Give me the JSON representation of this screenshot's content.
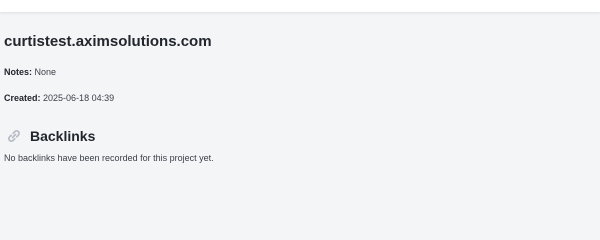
{
  "project": {
    "title": "curtistest.aximsolutions.com",
    "notes_label": "Notes:",
    "notes_value": "None",
    "created_label": "Created:",
    "created_value": "2025-06-18 04:39"
  },
  "backlinks": {
    "icon": "link-icon",
    "heading": "Backlinks",
    "empty_message": "No backlinks have been recorded for this project yet."
  },
  "colors": {
    "background": "#f4f5f7",
    "text": "#22262d",
    "icon": "#b9bec6"
  }
}
